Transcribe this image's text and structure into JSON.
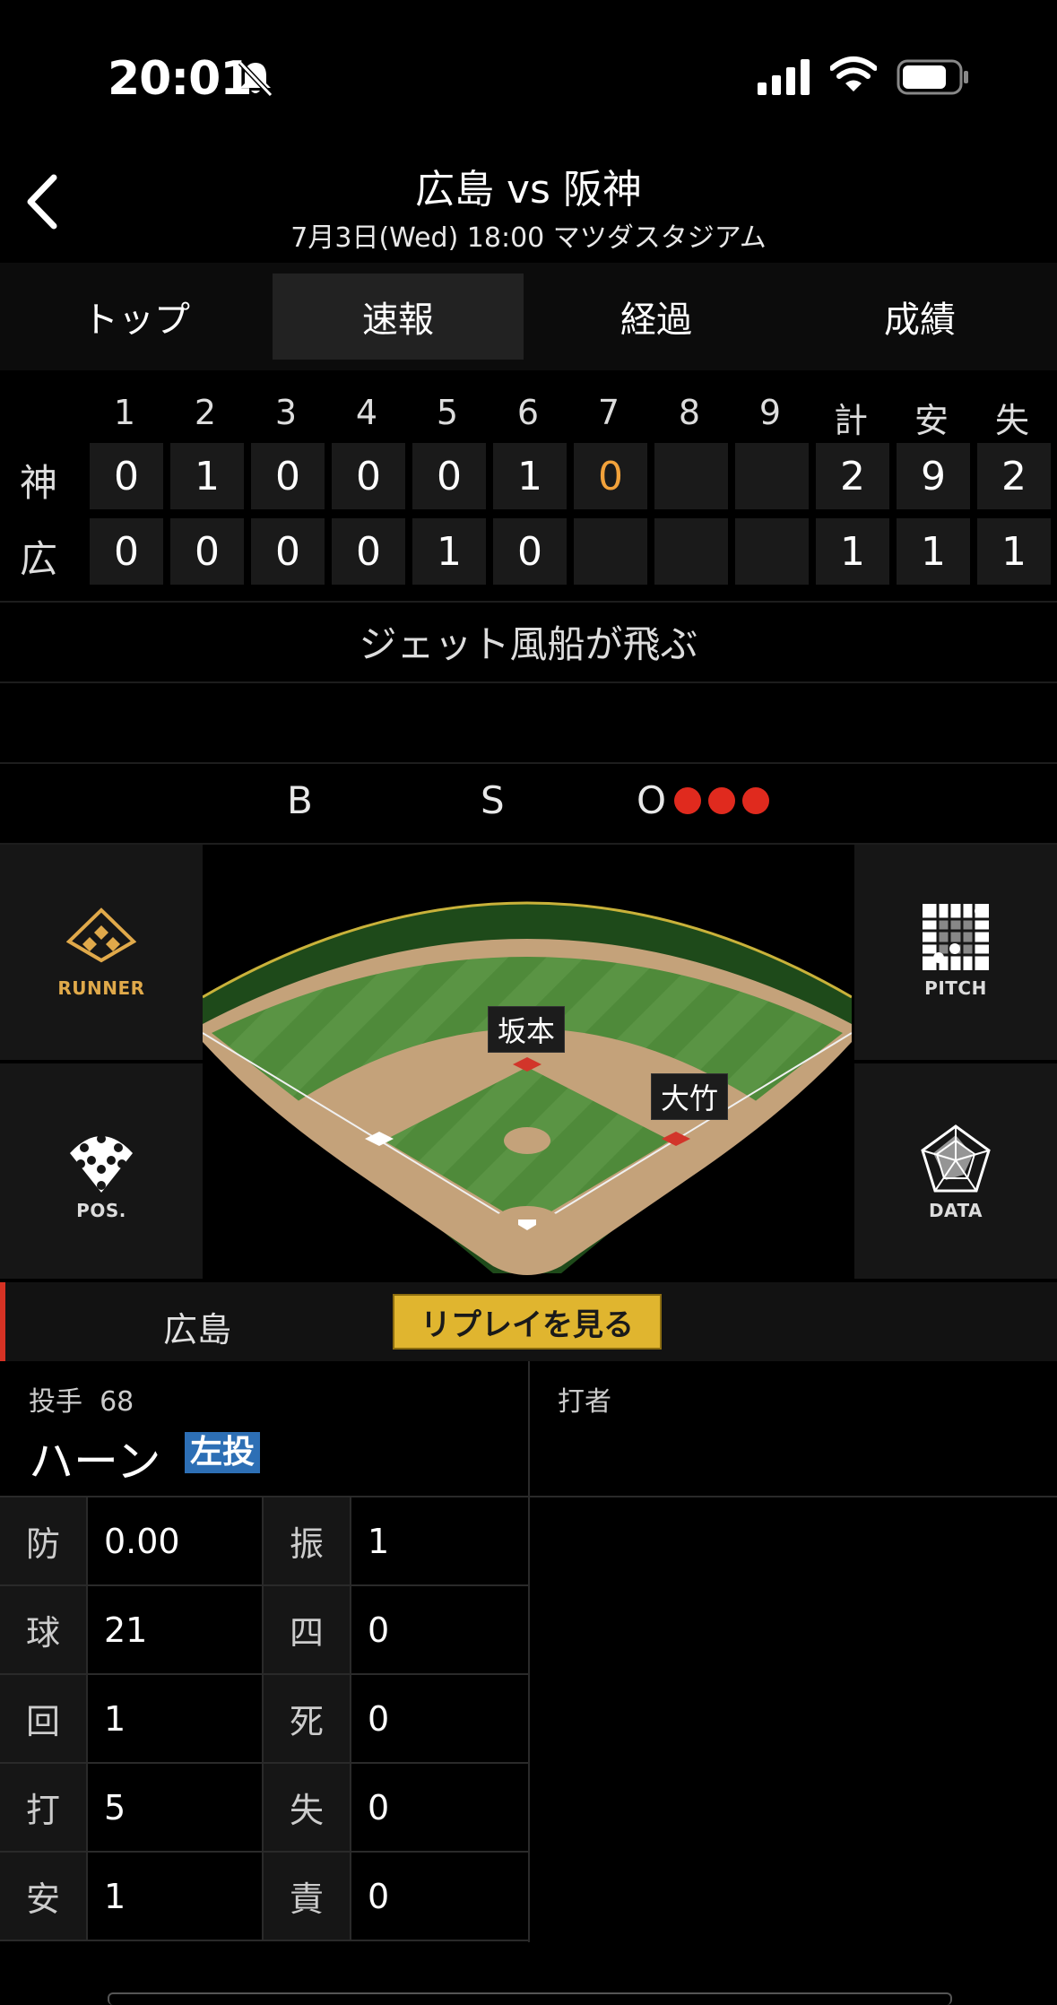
{
  "status_bar": {
    "time": "20:01",
    "icons": [
      "bell-slash-icon",
      "signal-icon",
      "wifi-icon",
      "battery-icon"
    ]
  },
  "header": {
    "title": "広島 vs 阪神",
    "subtitle": "7月3日(Wed) 18:00 マツダスタジアム"
  },
  "tabs": [
    {
      "label": "トップ",
      "active": false
    },
    {
      "label": "速報",
      "active": true
    },
    {
      "label": "経過",
      "active": false
    },
    {
      "label": "成績",
      "active": false
    }
  ],
  "scoreboard": {
    "headers": [
      "1",
      "2",
      "3",
      "4",
      "5",
      "6",
      "7",
      "8",
      "9",
      "計",
      "安",
      "失"
    ],
    "rows": [
      {
        "team": "神",
        "innings": [
          "0",
          "1",
          "0",
          "0",
          "0",
          "1",
          "0",
          "",
          "",
          ""
        ],
        "totals": [
          "2",
          "9",
          "2"
        ]
      },
      {
        "team": "広",
        "innings": [
          "0",
          "0",
          "0",
          "0",
          "1",
          "0",
          "",
          "",
          "",
          ""
        ],
        "totals": [
          "1",
          "1",
          "1"
        ]
      }
    ],
    "highlight_color": "#f2a23b"
  },
  "comment": "ジェット風船が飛ぶ",
  "count": {
    "b_label": "B",
    "s_label": "S",
    "o_label": "O",
    "balls": 0,
    "strikes": 0,
    "outs": 3,
    "out_color": "#e02a1e"
  },
  "side_buttons": {
    "runner": "RUNNER",
    "pitch": "PITCH",
    "pos": "POS.",
    "data": "DATA"
  },
  "field": {
    "runners": [
      {
        "name": "坂本",
        "base": "2B"
      },
      {
        "name": "大竹",
        "base": "1B"
      }
    ]
  },
  "team_bar": {
    "team": "広島",
    "replay": "リプレイを見る"
  },
  "pitcher": {
    "label": "投手",
    "number": "68",
    "name": "ハーン",
    "throws": "左投"
  },
  "batter": {
    "label": "打者"
  },
  "stats": [
    {
      "k1": "防",
      "v1": "0.00",
      "k2": "振",
      "v2": "1"
    },
    {
      "k1": "球",
      "v1": "21",
      "k2": "四",
      "v2": "0"
    },
    {
      "k1": "回",
      "v1": "1",
      "k2": "死",
      "v2": "0"
    },
    {
      "k1": "打",
      "v1": "5",
      "k2": "失",
      "v2": "0"
    },
    {
      "k1": "安",
      "v1": "1",
      "k2": "責",
      "v2": "0"
    }
  ]
}
